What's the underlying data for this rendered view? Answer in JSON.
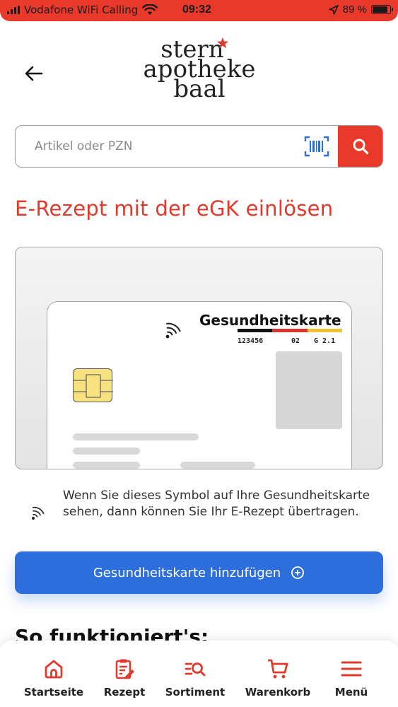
{
  "status_bar": {
    "carrier": "Vodafone WiFi Calling",
    "time": "09:32",
    "battery_percent": "89 %",
    "battery_level": 0.89
  },
  "header": {
    "logo": [
      "stern",
      "apotheke",
      "baal"
    ],
    "back_icon": "arrow-left-icon"
  },
  "search": {
    "placeholder": "Artikel oder PZN",
    "value": "",
    "barcode_icon": "barcode-scan-icon",
    "search_icon": "search-icon"
  },
  "main": {
    "title": "E-Rezept mit der eGK einlösen",
    "card": {
      "heading": "Gesundheitskarte",
      "number": "123456",
      "field2": "02",
      "field3": "G 2.1"
    },
    "info_text": "Wenn Sie dieses Symbol auf Ihre Gesundheitskarte sehen, dann können Sie Ihr E-Rezept übertragen.",
    "add_button_label": "Gesundheitskarte hinzufügen",
    "section_heading": "So funktioniert's:"
  },
  "bottom_nav": {
    "items": [
      {
        "label": "Startseite",
        "icon": "home-icon"
      },
      {
        "label": "Rezept",
        "icon": "prescription-icon"
      },
      {
        "label": "Sortiment",
        "icon": "assortment-search-icon"
      },
      {
        "label": "Warenkorb",
        "icon": "cart-icon"
      },
      {
        "label": "Menü",
        "icon": "menu-icon"
      }
    ]
  },
  "colors": {
    "accent_red": "#e8392b",
    "primary_blue": "#2c6fdc",
    "chip_yellow": "#f7e27f",
    "flag_black": "#111111",
    "flag_red": "#d8352a",
    "flag_gold": "#f2c230"
  }
}
